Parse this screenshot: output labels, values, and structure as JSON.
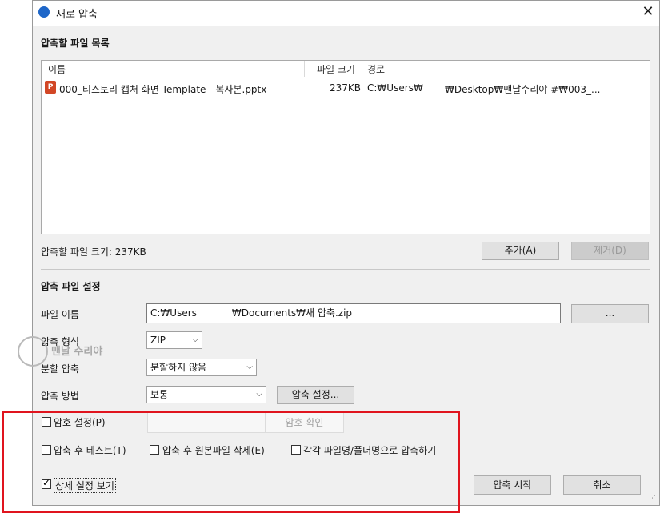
{
  "window": {
    "title": "새로 압축",
    "close_icon": "close-icon"
  },
  "file_list": {
    "section_title": "압축할 파일 목록",
    "columns": [
      "이름",
      "파일 크기",
      "경로"
    ],
    "rows": [
      {
        "name": "000_티스토리 캡처 화면 Template - 복사본.pptx",
        "size": "237KB",
        "path_start": "C:₩Users₩",
        "path_end": "₩Desktop₩맨날수리야 #₩003_..."
      }
    ],
    "total_size_label": "압축할 파일 크기: 237KB",
    "add_button": "추가(A)",
    "remove_button": "제거(D)"
  },
  "settings": {
    "section_title": "압축 파일 설정",
    "file_name_label": "파일 이름",
    "file_name_value_start": "C:₩Users",
    "file_name_value_end": "₩Documents₩새 압축.zip",
    "browse_button": "...",
    "format_label": "압축 형식",
    "format_value": "ZIP",
    "split_label": "분할 압축",
    "split_value": "분할하지 않음",
    "method_label": "압축 방법",
    "method_value": "보통",
    "method_settings_button": "압축 설정..."
  },
  "options": {
    "password_label": "암호 설정(P)",
    "password_confirm_placeholder": "암호 확인",
    "test_label": "압축 후 테스트(T)",
    "delete_label": "압축 후 원본파일 삭제(E)",
    "each_label": "각각 파일명/폴더명으로 압축하기",
    "detail_label": "상세 설정 보기"
  },
  "actions": {
    "start_button": "압축 시작",
    "cancel_button": "취소"
  },
  "watermark": {
    "text": "맨날 수리야"
  },
  "colors": {
    "highlight_box": "#e0141e",
    "accent_icon": "#1e66c8"
  }
}
